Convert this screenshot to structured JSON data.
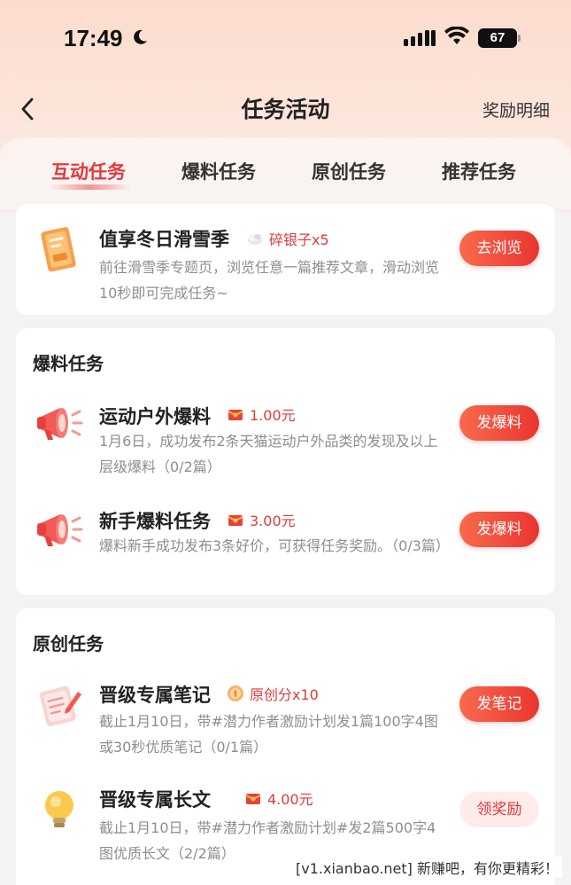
{
  "status_bar": {
    "time": "17:49",
    "battery": "67"
  },
  "nav": {
    "title": "任务活动",
    "right_link": "奖励明细"
  },
  "tabs": [
    {
      "label": "互动任务"
    },
    {
      "label": "爆料任务"
    },
    {
      "label": "原创任务"
    },
    {
      "label": "推荐任务"
    }
  ],
  "featured": {
    "title": "值享冬日滑雪季",
    "reward": "碎银子x5",
    "desc": "前往滑雪季专题页，浏览任意一篇推荐文章，滑动浏览10秒即可完成任务~",
    "button": "去浏览"
  },
  "baoliao": {
    "title": "爆料任务",
    "tasks": [
      {
        "title": "运动户外爆料",
        "reward": "1.00元",
        "desc": "1月6日，成功发布2条天猫运动户外品类的发现及以上层级爆料（0/2篇）",
        "button": "发爆料"
      },
      {
        "title": "新手爆料任务",
        "reward": "3.00元",
        "desc": "爆料新手成功发布3条好价，可获得任务奖励。（0/3篇）",
        "button": "发爆料"
      }
    ]
  },
  "yuanchuang": {
    "title": "原创任务",
    "tasks": [
      {
        "title": "晋级专属笔记",
        "reward": "原创分x10",
        "desc": "截止1月10日，带#潜力作者激励计划发1篇100字4图或30秒优质笔记（0/1篇）",
        "button": "发笔记"
      },
      {
        "title": "晋级专属长文",
        "reward": "4.00元",
        "desc": "截止1月10日，带#潜力作者激励计划#发2篇500字4图优质长文（2/2篇）",
        "button": "领奖励"
      }
    ]
  },
  "watermark": "[v1.xianbao.net] 新赚吧，有你更精彩！",
  "colors": {
    "accent": "#e2393c",
    "button_gradient_start": "#f86a4d",
    "button_gradient_end": "#ea3530"
  }
}
